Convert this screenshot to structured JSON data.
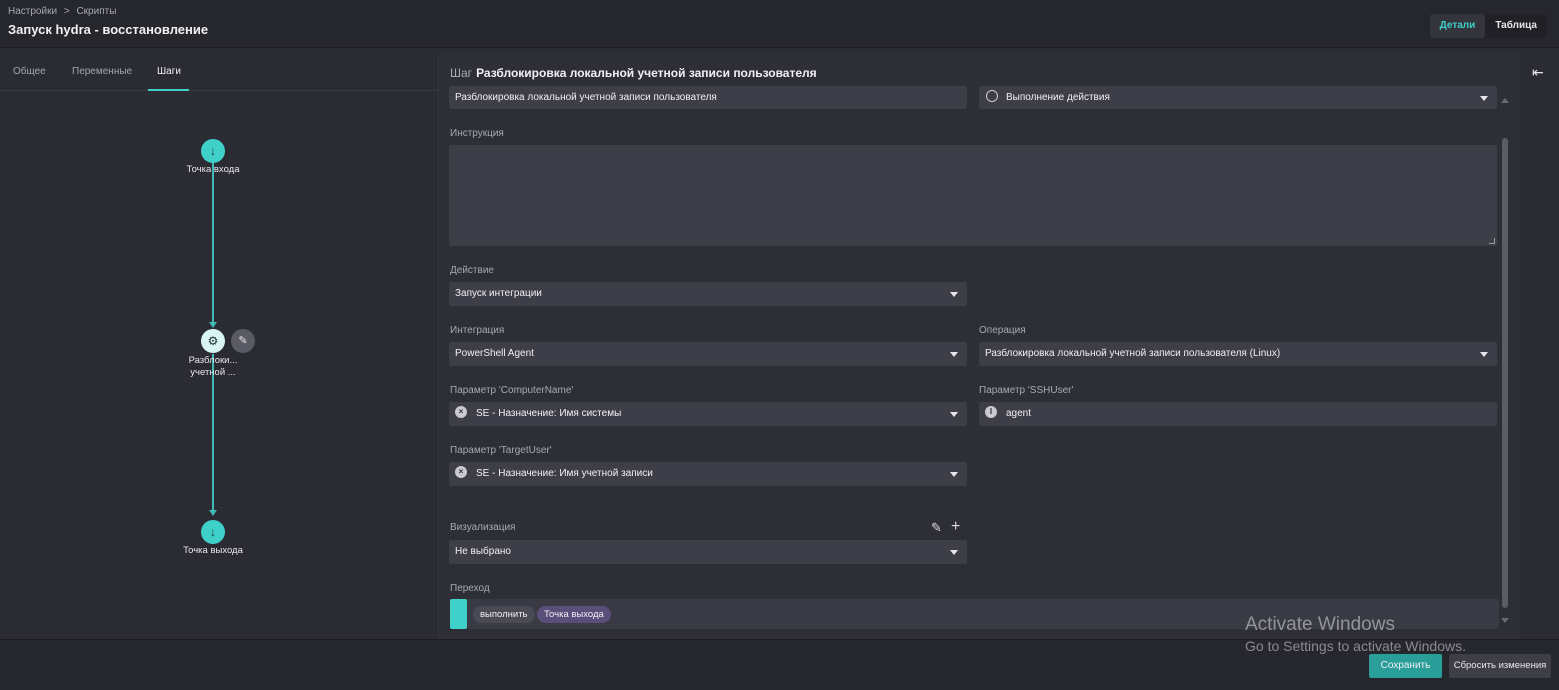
{
  "header": {
    "breadcrumb": [
      "Настройки",
      "Скрипты"
    ],
    "title": "Запуск hydra - восстановление",
    "view_toggle": {
      "details": "Детали",
      "table": "Таблица"
    }
  },
  "tabs": [
    "Общее",
    "Переменные",
    "Шаги"
  ],
  "flow": {
    "entry_label": "Точка входа",
    "step_label_line1": "Разблоки...",
    "step_label_line2": "учетной ...",
    "exit_label": "Точка выхода"
  },
  "step": {
    "prefix": "Шаг",
    "name": "Разблокировка локальной учетной записи пользователя",
    "name_field": "Разблокировка локальной учетной записи пользователя",
    "type_field": "Выполнение действия",
    "instruction_label": "Инструкция",
    "action_label": "Действие",
    "action_value": "Запуск интеграции",
    "integration_label": "Интеграция",
    "integration_value": "PowerShell Agent",
    "operation_label": "Операция",
    "operation_value": "Разблокировка локальной учетной записи пользователя (Linux)",
    "param_computer_label": "Параметр 'ComputerName'",
    "param_computer_value": "SE - Назначение: Имя системы",
    "param_sshuser_label": "Параметр 'SSHUser'",
    "param_sshuser_value": "agent",
    "param_target_label": "Параметр 'TargetUser'",
    "param_target_value": "SE - Назначение: Имя учетной записи",
    "viz_label": "Визуализация",
    "viz_value": "Не выбрано",
    "transition_label": "Переход",
    "transition_chip_action": "выполнить",
    "transition_chip_target": "Точка выхода"
  },
  "footer": {
    "save": "Сохранить",
    "reset": "Сбросить изменения"
  },
  "watermark": {
    "line1": "Activate Windows",
    "line2": "Go to Settings to activate Windows."
  },
  "colors": {
    "accent": "#3fd0c9",
    "save_button": "#2a9e99",
    "chip_target": "#5a4e7a"
  }
}
